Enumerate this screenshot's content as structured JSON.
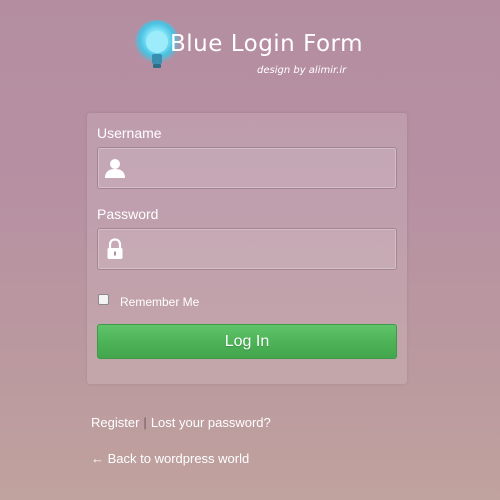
{
  "logo": {
    "title": "Blue Login Form",
    "subtitle": "design by alimir.ir",
    "icon": "lightbulb-icon"
  },
  "form": {
    "username_label": "Username",
    "username_value": "",
    "username_icon": "user-icon",
    "password_label": "Password",
    "password_value": "",
    "password_icon": "lock-icon",
    "remember_label": "Remember Me",
    "remember_checked": false,
    "login_label": "Log In"
  },
  "links": {
    "register": "Register",
    "separator": "|",
    "lost_password": "Lost your password?",
    "back": "← Back to wordpress world"
  },
  "colors": {
    "button_green": "#4cb256",
    "logo_blue": "#5fd8f0"
  }
}
